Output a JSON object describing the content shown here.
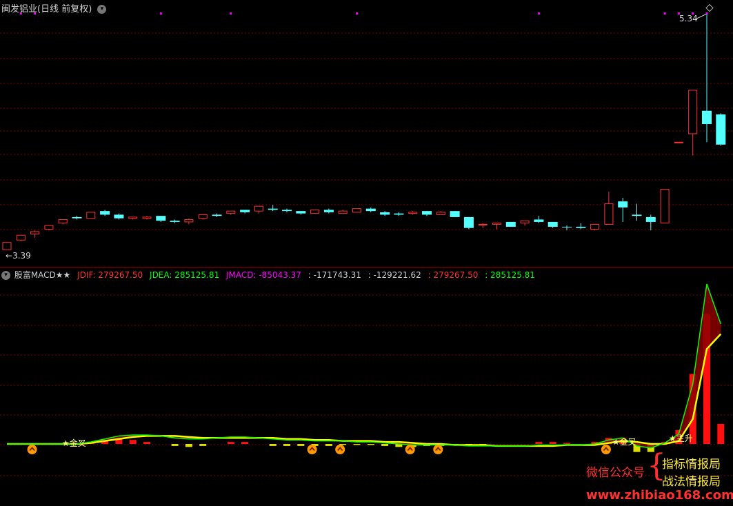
{
  "title": {
    "stock_name": "闽发铝业",
    "period": "(日线 前复权)",
    "dropdown_icon": "chevron-down-icon"
  },
  "price_labels": {
    "high": "5.34",
    "low": "3.39"
  },
  "indicator_header": {
    "name": "股富MACD★★",
    "jdif_label": "JDIF: 279267.50",
    "jdea_label": "JDEA: 285125.81",
    "jmacd_label": "JMACD: -85043.37",
    "val4": ": -171743.31",
    "val5": ": -129221.62",
    "val6": ": 279267.50",
    "val7": ": 285125.81"
  },
  "signals": {
    "golden_cross_1": "★金叉",
    "golden_cross_2": "★金叉",
    "rise": "★主升"
  },
  "watermark": {
    "wechat": "微信公众号",
    "line1": "指标情报局",
    "line2": "战法情报局",
    "url": "www.zhibiao168.com"
  },
  "colors": {
    "up": "#ff3232",
    "down": "#54ffff",
    "dif": "#ffff00",
    "dea": "#00ff00",
    "grid": "#800000",
    "magenta": "#ff00ff"
  },
  "candles": [
    {
      "o": 3.39,
      "h": 3.45,
      "l": 3.39,
      "c": 3.45,
      "up": true
    },
    {
      "o": 3.47,
      "h": 3.51,
      "l": 3.46,
      "c": 3.51,
      "up": true
    },
    {
      "o": 3.52,
      "h": 3.55,
      "l": 3.49,
      "c": 3.54,
      "up": true
    },
    {
      "o": 3.56,
      "h": 3.59,
      "l": 3.55,
      "c": 3.59,
      "up": true
    },
    {
      "o": 3.61,
      "h": 3.64,
      "l": 3.6,
      "c": 3.64,
      "up": true
    },
    {
      "o": 3.66,
      "h": 3.67,
      "l": 3.64,
      "c": 3.65,
      "up": false
    },
    {
      "o": 3.65,
      "h": 3.7,
      "l": 3.65,
      "c": 3.7,
      "up": true
    },
    {
      "o": 3.71,
      "h": 3.72,
      "l": 3.67,
      "c": 3.68,
      "up": false
    },
    {
      "o": 3.68,
      "h": 3.69,
      "l": 3.64,
      "c": 3.65,
      "up": false
    },
    {
      "o": 3.65,
      "h": 3.66,
      "l": 3.64,
      "c": 3.66,
      "up": true
    },
    {
      "o": 3.65,
      "h": 3.67,
      "l": 3.64,
      "c": 3.66,
      "up": true
    },
    {
      "o": 3.67,
      "h": 3.67,
      "l": 3.62,
      "c": 3.63,
      "up": false
    },
    {
      "o": 3.63,
      "h": 3.64,
      "l": 3.61,
      "c": 3.62,
      "up": false
    },
    {
      "o": 3.62,
      "h": 3.65,
      "l": 3.6,
      "c": 3.64,
      "up": true
    },
    {
      "o": 3.65,
      "h": 3.68,
      "l": 3.64,
      "c": 3.68,
      "up": true
    },
    {
      "o": 3.68,
      "h": 3.69,
      "l": 3.66,
      "c": 3.67,
      "up": false
    },
    {
      "o": 3.69,
      "h": 3.71,
      "l": 3.68,
      "c": 3.71,
      "up": true
    },
    {
      "o": 3.72,
      "h": 3.72,
      "l": 3.69,
      "c": 3.7,
      "up": false
    },
    {
      "o": 3.71,
      "h": 3.75,
      "l": 3.69,
      "c": 3.75,
      "up": true
    },
    {
      "o": 3.73,
      "h": 3.76,
      "l": 3.71,
      "c": 3.72,
      "up": false
    },
    {
      "o": 3.72,
      "h": 3.73,
      "l": 3.7,
      "c": 3.71,
      "up": false
    },
    {
      "o": 3.71,
      "h": 3.71,
      "l": 3.68,
      "c": 3.69,
      "up": false
    },
    {
      "o": 3.69,
      "h": 3.72,
      "l": 3.69,
      "c": 3.72,
      "up": true
    },
    {
      "o": 3.72,
      "h": 3.73,
      "l": 3.69,
      "c": 3.7,
      "up": false
    },
    {
      "o": 3.69,
      "h": 3.72,
      "l": 3.69,
      "c": 3.71,
      "up": true
    },
    {
      "o": 3.7,
      "h": 3.73,
      "l": 3.7,
      "c": 3.73,
      "up": true
    },
    {
      "o": 3.73,
      "h": 3.74,
      "l": 3.7,
      "c": 3.71,
      "up": false
    },
    {
      "o": 3.7,
      "h": 3.71,
      "l": 3.67,
      "c": 3.68,
      "up": false
    },
    {
      "o": 3.69,
      "h": 3.7,
      "l": 3.67,
      "c": 3.68,
      "up": false
    },
    {
      "o": 3.69,
      "h": 3.71,
      "l": 3.68,
      "c": 3.7,
      "up": true
    },
    {
      "o": 3.71,
      "h": 3.71,
      "l": 3.67,
      "c": 3.68,
      "up": false
    },
    {
      "o": 3.68,
      "h": 3.71,
      "l": 3.68,
      "c": 3.7,
      "up": true
    },
    {
      "o": 3.71,
      "h": 3.71,
      "l": 3.66,
      "c": 3.66,
      "up": false
    },
    {
      "o": 3.66,
      "h": 3.66,
      "l": 3.56,
      "c": 3.57,
      "up": false
    },
    {
      "o": 3.6,
      "h": 3.61,
      "l": 3.57,
      "c": 3.6,
      "up": true
    },
    {
      "o": 3.61,
      "h": 3.61,
      "l": 3.56,
      "c": 3.6,
      "up": true
    },
    {
      "o": 3.62,
      "h": 3.62,
      "l": 3.58,
      "c": 3.58,
      "up": false
    },
    {
      "o": 3.61,
      "h": 3.63,
      "l": 3.59,
      "c": 3.63,
      "up": true
    },
    {
      "o": 3.64,
      "h": 3.67,
      "l": 3.61,
      "c": 3.62,
      "up": false
    },
    {
      "o": 3.62,
      "h": 3.62,
      "l": 3.57,
      "c": 3.58,
      "up": false
    },
    {
      "o": 3.58,
      "h": 3.59,
      "l": 3.55,
      "c": 3.58,
      "up": false
    },
    {
      "o": 3.58,
      "h": 3.61,
      "l": 3.56,
      "c": 3.57,
      "up": false
    },
    {
      "o": 3.56,
      "h": 3.6,
      "l": 3.55,
      "c": 3.6,
      "up": true
    },
    {
      "o": 3.6,
      "h": 3.87,
      "l": 3.6,
      "c": 3.77,
      "up": true
    },
    {
      "o": 3.79,
      "h": 3.82,
      "l": 3.62,
      "c": 3.74,
      "up": false
    },
    {
      "o": 3.68,
      "h": 3.77,
      "l": 3.63,
      "c": 3.67,
      "up": false
    },
    {
      "o": 3.66,
      "h": 3.68,
      "l": 3.55,
      "c": 3.62,
      "up": false
    },
    {
      "o": 3.61,
      "h": 3.89,
      "l": 3.61,
      "c": 3.89,
      "up": true
    },
    {
      "o": 4.28,
      "h": 4.28,
      "l": 4.28,
      "c": 4.28,
      "up": true
    },
    {
      "o": 4.35,
      "h": 4.71,
      "l": 4.17,
      "c": 4.71,
      "up": true
    },
    {
      "o": 4.54,
      "h": 5.34,
      "l": 4.28,
      "c": 4.43,
      "up": false
    },
    {
      "o": 4.51,
      "h": 4.52,
      "l": 4.25,
      "c": 4.26,
      "up": false
    }
  ],
  "macd": {
    "dif": [
      0,
      0,
      0,
      0,
      0,
      0,
      2,
      5,
      8,
      9,
      9,
      8,
      6,
      5,
      5,
      6,
      7,
      7,
      6,
      5,
      4,
      4,
      3,
      3,
      3,
      2,
      2,
      1,
      0,
      -1,
      -1,
      -1,
      -1,
      -2,
      -2,
      -2,
      -2,
      -2,
      -1,
      -1,
      -1,
      -1,
      0,
      4,
      6,
      -2,
      -4,
      1,
      10,
      60,
      160,
      120
    ],
    "dea": [
      0,
      0,
      0,
      0,
      0,
      0,
      1,
      3,
      5,
      7,
      8,
      8,
      8,
      7,
      6,
      6,
      6,
      6,
      6,
      6,
      5,
      5,
      4,
      4,
      3,
      3,
      3,
      2,
      2,
      1,
      0,
      0,
      -1,
      -1,
      -1,
      -2,
      -2,
      -2,
      -2,
      -2,
      -1,
      -1,
      -1,
      1,
      3,
      2,
      0,
      0,
      3,
      25,
      95,
      110
    ],
    "hist": [
      0,
      0,
      0,
      0,
      0,
      0,
      2,
      4,
      6,
      4,
      2,
      0,
      -2,
      -3,
      -2,
      0,
      2,
      2,
      0,
      -2,
      -2,
      -2,
      -2,
      -2,
      -1,
      -1,
      -1,
      -2,
      -3,
      -3,
      -2,
      -2,
      -1,
      -2,
      -2,
      0,
      0,
      0,
      2,
      2,
      1,
      0,
      2,
      6,
      6,
      -8,
      -8,
      2,
      14,
      70,
      130,
      20
    ]
  },
  "magenta_marks": [
    1,
    2,
    11,
    16,
    25,
    38,
    47,
    48,
    49,
    50
  ]
}
